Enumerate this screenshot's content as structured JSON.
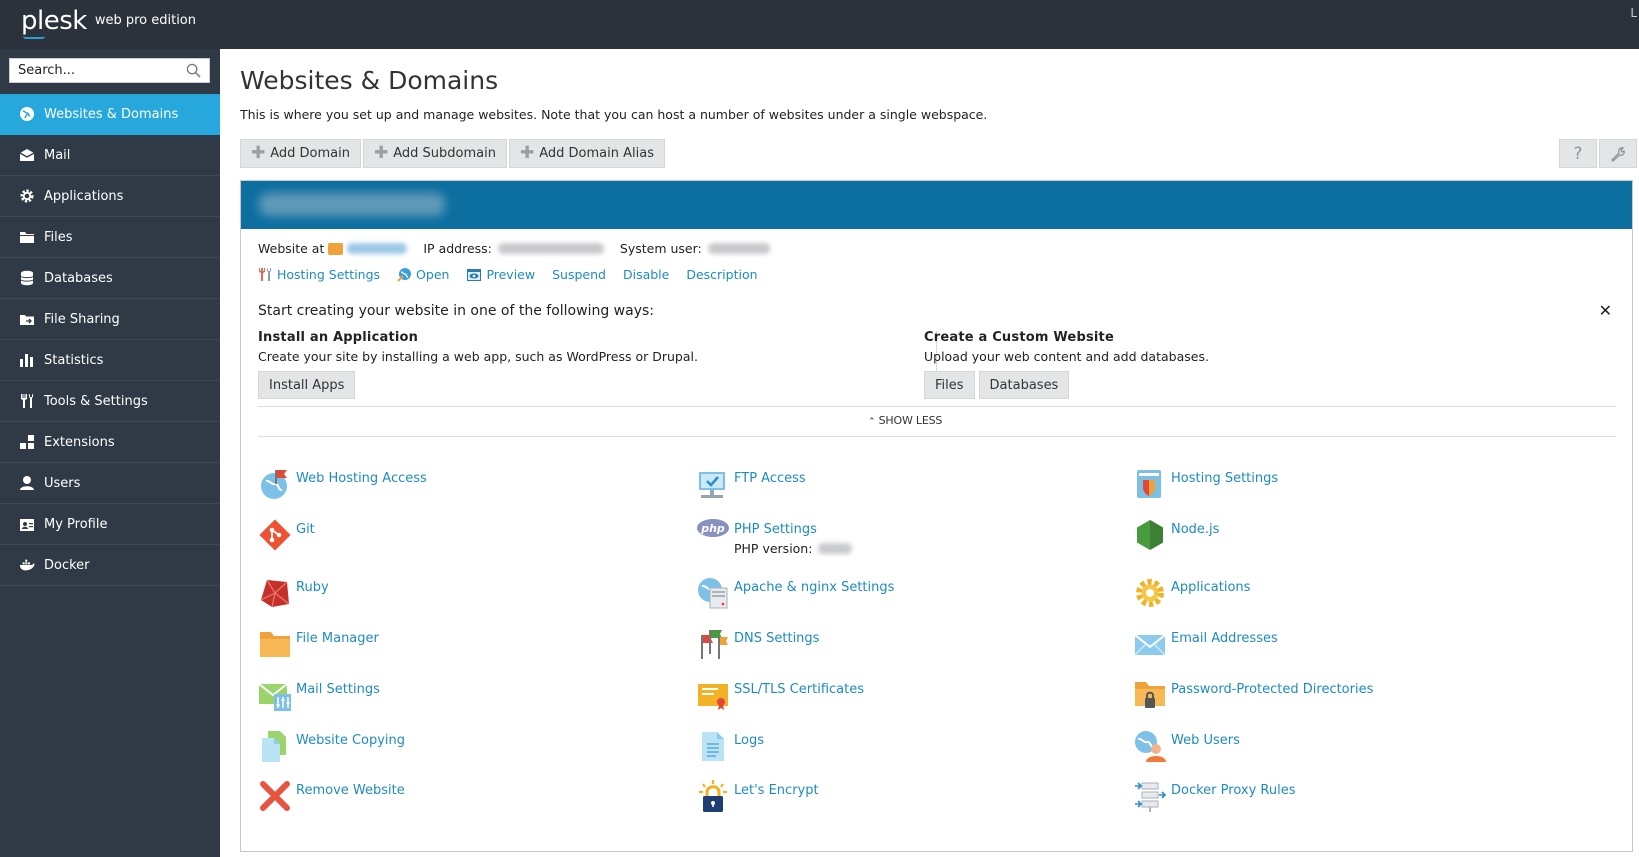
{
  "header": {
    "brand": "plesk",
    "edition": "web pro edition",
    "corner_text": "L"
  },
  "sidebar": {
    "search_placeholder": "Search...",
    "items": [
      {
        "label": "Websites & Domains",
        "icon": "globe-icon",
        "active": true
      },
      {
        "label": "Mail",
        "icon": "mail-icon"
      },
      {
        "label": "Applications",
        "icon": "gear-icon"
      },
      {
        "label": "Files",
        "icon": "folder-icon"
      },
      {
        "label": "Databases",
        "icon": "database-icon"
      },
      {
        "label": "File Sharing",
        "icon": "file-sharing-icon"
      },
      {
        "label": "Statistics",
        "icon": "bar-chart-icon"
      },
      {
        "label": "Tools & Settings",
        "icon": "tools-icon"
      },
      {
        "label": "Extensions",
        "icon": "extensions-icon"
      },
      {
        "label": "Users",
        "icon": "user-icon"
      },
      {
        "label": "My Profile",
        "icon": "profile-icon"
      },
      {
        "label": "Docker",
        "icon": "docker-icon"
      }
    ]
  },
  "main": {
    "title": "Websites & Domains",
    "intro": "This is where you set up and manage websites. Note that you can host a number of websites under a single webspace.",
    "toolbar": {
      "add_domain": "Add Domain",
      "add_subdomain": "Add Subdomain",
      "add_domain_alias": "Add Domain Alias",
      "help_icon": "question-icon",
      "settings_icon": "wrench-icon"
    },
    "domain": {
      "website_at_label": "Website at",
      "ip_label": "IP address:",
      "sysuser_label": "System user:",
      "actions": {
        "hosting_settings": "Hosting Settings",
        "open": "Open",
        "preview": "Preview",
        "suspend": "Suspend",
        "disable": "Disable",
        "description": "Description"
      }
    },
    "start": {
      "title": "Start creating your website in one of the following ways:",
      "install": {
        "heading": "Install an Application",
        "text": "Create your site by installing a web app, such as WordPress or Drupal.",
        "button": "Install Apps"
      },
      "custom": {
        "heading": "Create a Custom Website",
        "text": "Upload your web content and add databases.",
        "files_button": "Files",
        "databases_button": "Databases"
      },
      "show_less": "SHOW LESS"
    },
    "tools": [
      {
        "label": "Web Hosting Access",
        "icon": "web-hosting-access-icon"
      },
      {
        "label": "FTP Access",
        "icon": "ftp-access-icon"
      },
      {
        "label": "Hosting Settings",
        "icon": "hosting-settings-icon"
      },
      {
        "label": "Git",
        "icon": "git-icon"
      },
      {
        "label": "PHP Settings",
        "icon": "php-icon",
        "sub": "PHP version:"
      },
      {
        "label": "Node.js",
        "icon": "nodejs-icon"
      },
      {
        "label": "Ruby",
        "icon": "ruby-icon"
      },
      {
        "label": "Apache & nginx Settings",
        "icon": "apache-nginx-icon"
      },
      {
        "label": "Applications",
        "icon": "applications-gear-icon"
      },
      {
        "label": "File Manager",
        "icon": "file-manager-icon"
      },
      {
        "label": "DNS Settings",
        "icon": "dns-settings-icon"
      },
      {
        "label": "Email Addresses",
        "icon": "email-addresses-icon"
      },
      {
        "label": "Mail Settings",
        "icon": "mail-settings-icon"
      },
      {
        "label": "SSL/TLS Certificates",
        "icon": "ssl-certificate-icon"
      },
      {
        "label": "Password-Protected Directories",
        "icon": "protected-directory-icon"
      },
      {
        "label": "Website Copying",
        "icon": "website-copying-icon"
      },
      {
        "label": "Logs",
        "icon": "logs-icon"
      },
      {
        "label": "Web Users",
        "icon": "web-users-icon"
      },
      {
        "label": "Remove Website",
        "icon": "remove-website-icon"
      },
      {
        "label": "Let's Encrypt",
        "icon": "lets-encrypt-icon"
      },
      {
        "label": "Docker Proxy Rules",
        "icon": "docker-proxy-rules-icon"
      }
    ]
  },
  "colors": {
    "header_bg": "#2b323b",
    "sidebar_bg": "#2f3a46",
    "active_nav": "#27a8dd",
    "domain_header": "#0c6f9f",
    "link": "#1e8bc3"
  }
}
